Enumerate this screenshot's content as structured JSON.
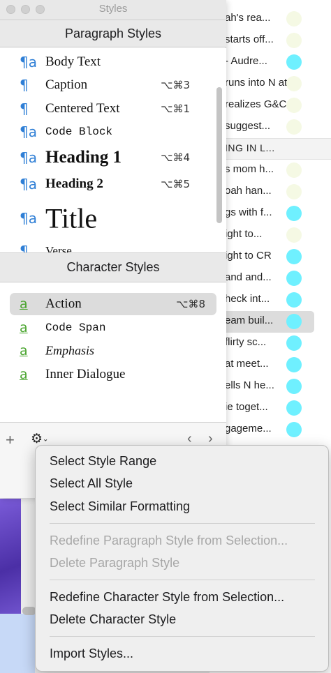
{
  "styles_panel": {
    "title": "Styles",
    "paragraph_header": "Paragraph Styles",
    "character_header": "Character Styles",
    "paragraph_styles": [
      {
        "name": "Body Text",
        "shortcut": ""
      },
      {
        "name": "Caption",
        "shortcut": "⌥⌘3"
      },
      {
        "name": "Centered Text",
        "shortcut": "⌥⌘1"
      },
      {
        "name": "Code Block",
        "shortcut": ""
      },
      {
        "name": "Heading 1",
        "shortcut": "⌥⌘4"
      },
      {
        "name": "Heading 2",
        "shortcut": "⌥⌘5"
      },
      {
        "name": "Title",
        "shortcut": ""
      },
      {
        "name": "Verse",
        "shortcut": ""
      }
    ],
    "character_styles": [
      {
        "name": "Action",
        "shortcut": "⌥⌘8",
        "selected": true
      },
      {
        "name": "Code Span",
        "shortcut": ""
      },
      {
        "name": "Emphasis",
        "shortcut": ""
      },
      {
        "name": "Inner Dialogue",
        "shortcut": ""
      }
    ],
    "icons": {
      "paragraph": "¶",
      "paragraph_text": "¶a",
      "character": "a",
      "plus": "+",
      "gear": "⚙",
      "chevron": "⌄",
      "prev": "‹",
      "next": "›"
    }
  },
  "context_menu": {
    "items": [
      {
        "label": "Select Style Range",
        "enabled": true
      },
      {
        "label": "Select All Style",
        "enabled": true
      },
      {
        "label": "Select Similar Formatting",
        "enabled": true
      },
      {
        "label": "Redefine Paragraph Style from Selection...",
        "enabled": false
      },
      {
        "label": "Delete Paragraph Style",
        "enabled": false
      },
      {
        "label": "Redefine Character Style from Selection...",
        "enabled": true
      },
      {
        "label": "Delete Character Style",
        "enabled": true
      },
      {
        "label": "Import Styles...",
        "enabled": true
      }
    ]
  },
  "background_outline": {
    "rows": [
      {
        "text": "ah's rea...",
        "dot": "#f5f9e4"
      },
      {
        "text": "starts off...",
        "dot": "#f5f9e4"
      },
      {
        "text": "- Audre...",
        "dot": "#6ff0ff"
      },
      {
        "text": "runs into N at...",
        "dot": "#f5f9e4"
      },
      {
        "text": "realizes G&C...",
        "dot": "#f5f9e4"
      },
      {
        "text": "suggest...",
        "dot": "#f5f9e4"
      },
      {
        "text": "ING IN L...",
        "dot": ""
      },
      {
        "text": "s mom h...",
        "dot": "#f5f9e4"
      },
      {
        "text": "oah han...",
        "dot": "#f5f9e4"
      },
      {
        "text": "gs with f...",
        "dot": "#6ff0ff"
      },
      {
        "text": "ight to...",
        "dot": "#f5f9e4"
      },
      {
        "text": "ight to CR",
        "dot": "#6ff0ff"
      },
      {
        "text": "and and...",
        "dot": "#6ff0ff"
      },
      {
        "text": "heck int...",
        "dot": "#6ff0ff"
      },
      {
        "text": "eam buil...",
        "dot": "#6ff0ff"
      },
      {
        "text": "flirty sc...",
        "dot": "#6ff0ff"
      },
      {
        "text": "at meet...",
        "dot": "#6ff0ff"
      },
      {
        "text": "ells N he...",
        "dot": "#6ff0ff"
      },
      {
        "text": "ie toget...",
        "dot": "#6ff0ff"
      },
      {
        "text": "gageme...",
        "dot": "#6ff0ff"
      }
    ]
  },
  "colors": {
    "paragraph_icon": "#2f7fd6",
    "character_icon": "#4aa52f",
    "status_cyan": "#6ff0ff",
    "status_pale": "#f5f9e4"
  }
}
